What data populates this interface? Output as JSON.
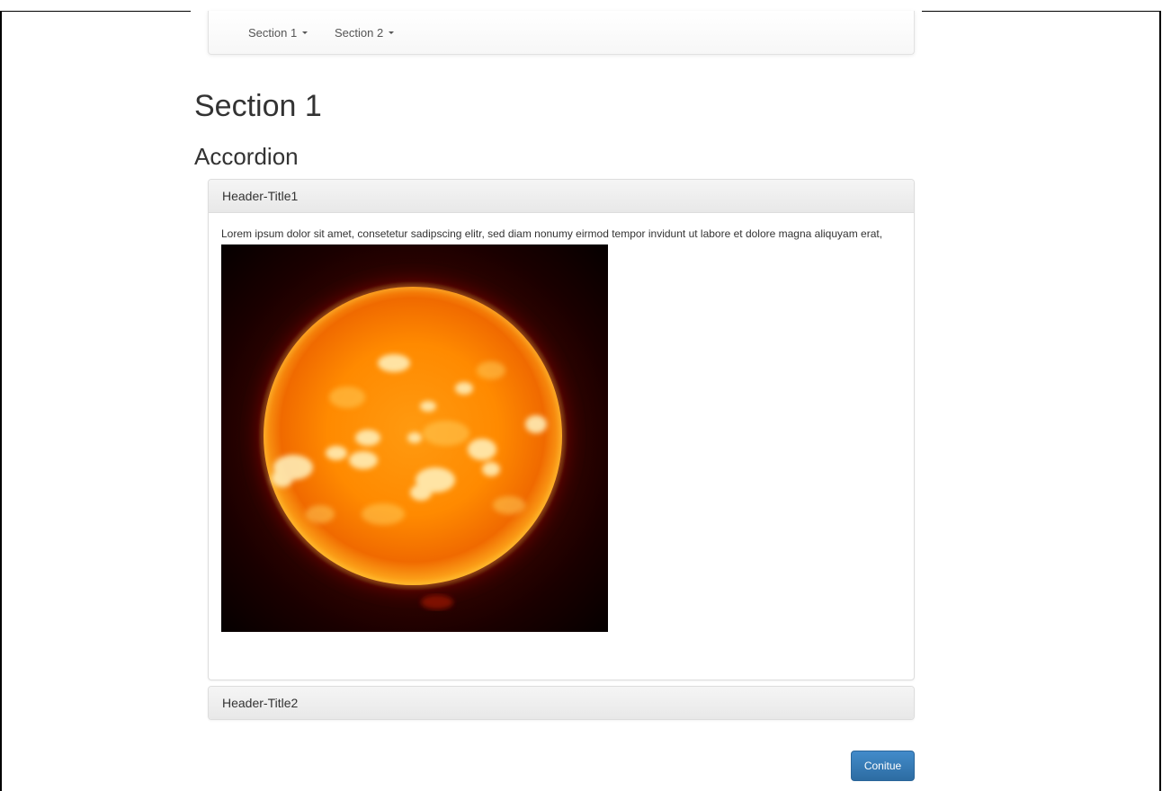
{
  "navbar": {
    "items": [
      {
        "label": "Section 1"
      },
      {
        "label": "Section 2"
      }
    ]
  },
  "page": {
    "title": "Section 1",
    "subtitle": "Accordion"
  },
  "accordion": {
    "panels": [
      {
        "header": "Header-Title1",
        "expanded": true,
        "text": "Lorem ipsum dolor sit amet, consetetur sadipscing elitr, sed diam nonumy eirmod tempor invidunt ut labore et dolore magna aliquyam erat, sed diam voluptua.",
        "image": "sun-photo"
      },
      {
        "header": "Header-Title2",
        "expanded": false
      }
    ]
  },
  "actions": {
    "continue_label": "Conitue"
  },
  "colors": {
    "primary_button": "#337ab7",
    "panel_heading": "#f5f5f5",
    "text": "#333333"
  }
}
